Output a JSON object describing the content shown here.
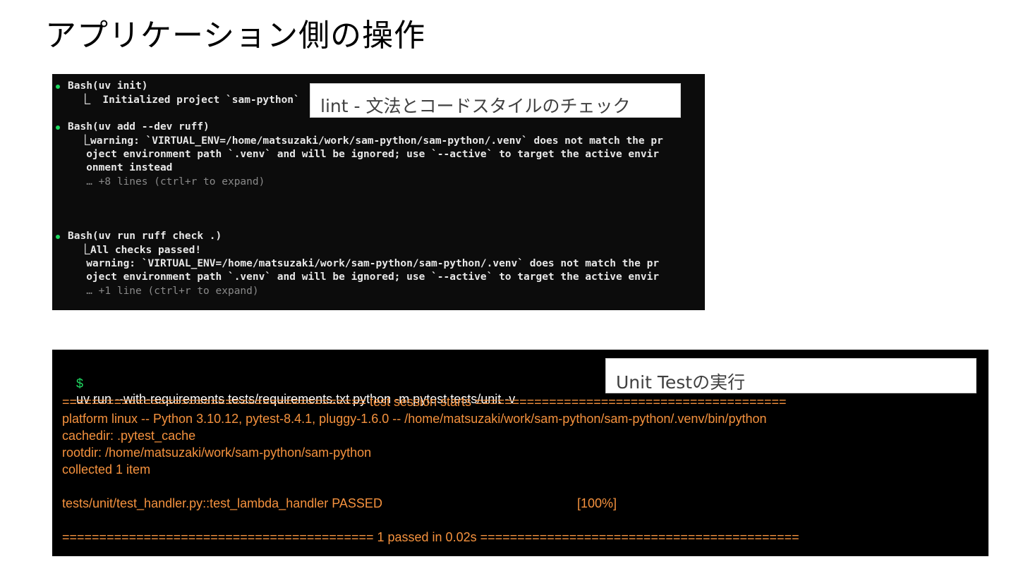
{
  "title": "アプリケーション側の操作",
  "lint_terminal": {
    "callout": "lint - 文法とコードスタイルのチェック",
    "lines": [
      "Bash(uv init)",
      "  ⎿  Initialized project `sam-python`",
      "Bash(uv add --dev ruff)",
      "  ⎿warning: `VIRTUAL_ENV=/home/matsuzaki/work/sam-python/sam-python/.venv` does not match the pr",
      "   oject environment path `.venv` and will be ignored; use `--active` to target the active envir",
      "   onment instead",
      "   … +8 lines (ctrl+r to expand)",
      "Bash(uv run ruff check .)",
      "  ⎿All checks passed!",
      "   warning: `VIRTUAL_ENV=/home/matsuzaki/work/sam-python/sam-python/.venv` does not match the pr",
      "   oject environment path `.venv` and will be ignored; use `--active` to target the active envir",
      "   … +1 line (ctrl+r to expand)"
    ]
  },
  "test_terminal": {
    "callout": "Unit Testの実行",
    "prompt": "$",
    "command": "uv run --with-requirements tests/requirements.txt python -m pytest tests/unit -v",
    "lines": [
      "========================================= test session starts ==========================================",
      "platform linux -- Python 3.10.12, pytest-8.4.1, pluggy-1.6.0 -- /home/matsuzaki/work/sam-python/sam-python/.venv/bin/python",
      "cachedir: .pytest_cache",
      "rootdir: /home/matsuzaki/work/sam-python/sam-python",
      "collected 1 item",
      "",
      "tests/unit/test_handler.py::test_lambda_handler PASSED",
      "",
      "========================================== 1 passed in 0.02s ==========================================="
    ],
    "progress": "[100%]"
  },
  "colors": {
    "terminal_bg": "#0c0c0c",
    "bullet_green": "#1ed760",
    "pytest_orange": "#f5923e"
  }
}
